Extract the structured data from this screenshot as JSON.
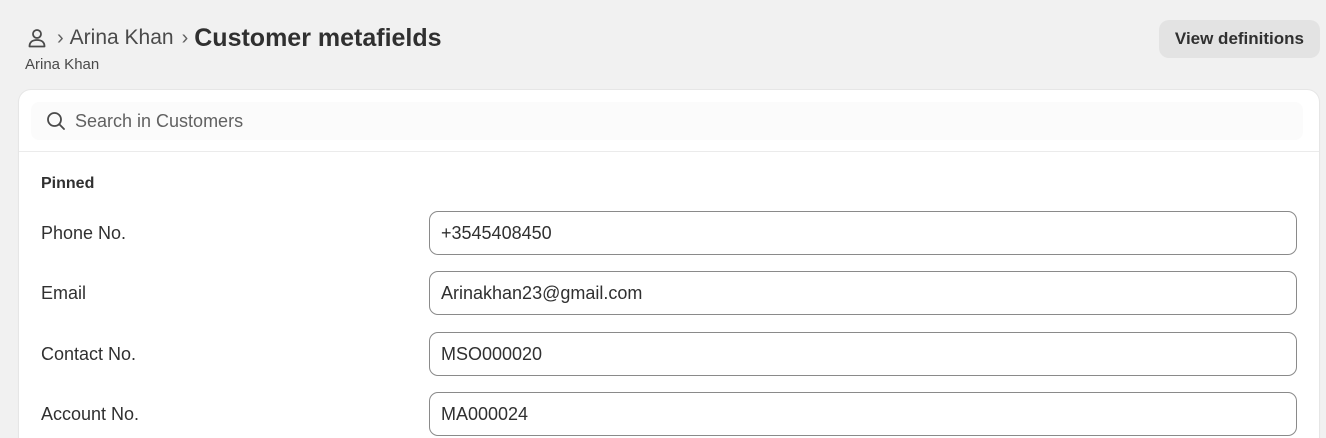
{
  "header": {
    "icon": "person-icon",
    "breadcrumb_parent": "Arina Khan",
    "title": "Customer metafields",
    "subtitle": "Arina Khan",
    "view_definitions_label": "View definitions"
  },
  "search": {
    "icon": "search-icon",
    "placeholder": "Search in Customers"
  },
  "pinned": {
    "section_label": "Pinned",
    "fields": [
      {
        "label": "Phone No.",
        "value": "+3545408450"
      },
      {
        "label": "Email",
        "value": "Arinakhan23@gmail.com"
      },
      {
        "label": "Contact No.",
        "value": "MSO000020"
      },
      {
        "label": "Account No.",
        "value": "MA000024"
      }
    ]
  }
}
